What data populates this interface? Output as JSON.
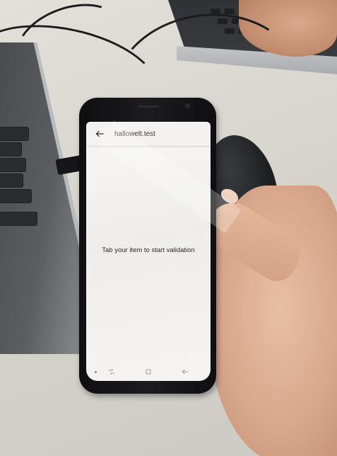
{
  "app": {
    "title": "hallowelt.test"
  },
  "content": {
    "message": "Tab your item to start validation"
  },
  "navigation": {
    "back_icon": "arrow-left-icon",
    "recent_icon": "recent-apps-icon",
    "home_icon": "home-icon",
    "back_nav_icon": "back-icon"
  },
  "colors": {
    "screen_bg": "#f5f4f2",
    "appbar_bg": "#f3f2f0",
    "text": "#2a2a2a",
    "phone_body": "#141416"
  }
}
